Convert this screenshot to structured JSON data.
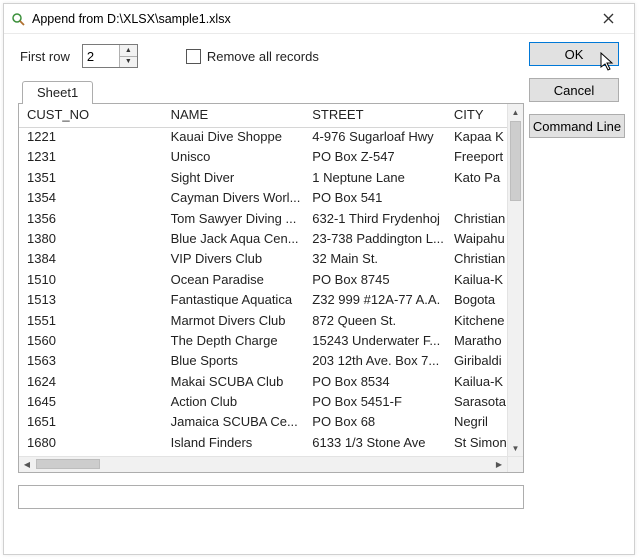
{
  "title": "Append from D:\\XLSX\\sample1.xlsx",
  "label_first_row": "First row",
  "first_row_value": "2",
  "checkbox_remove_label": "Remove all records",
  "buttons": {
    "ok": "OK",
    "cancel": "Cancel",
    "cmdline": "Command Line"
  },
  "sheet_tab": "Sheet1",
  "columns": [
    "CUST_NO",
    "NAME",
    "STREET",
    "CITY"
  ],
  "rows": [
    {
      "c0": "1221",
      "c1": "Kauai Dive Shoppe",
      "c2": "4-976 Sugarloaf Hwy",
      "c3": "Kapaa K"
    },
    {
      "c0": "1231",
      "c1": "Unisco",
      "c2": "PO Box Z-547",
      "c3": "Freeport"
    },
    {
      "c0": "1351",
      "c1": "Sight Diver",
      "c2": "1 Neptune Lane",
      "c3": "Kato Pa"
    },
    {
      "c0": "1354",
      "c1": "Cayman Divers Worl...",
      "c2": "PO Box 541",
      "c3": ""
    },
    {
      "c0": "1356",
      "c1": "Tom Sawyer Diving ...",
      "c2": "632-1 Third Frydenhoj",
      "c3": "Christian"
    },
    {
      "c0": "1380",
      "c1": "Blue Jack Aqua Cen...",
      "c2": "23-738 Paddington L...",
      "c3": "Waipahu"
    },
    {
      "c0": "1384",
      "c1": "VIP Divers Club",
      "c2": "32 Main St.",
      "c3": "Christian"
    },
    {
      "c0": "1510",
      "c1": "Ocean Paradise",
      "c2": "PO Box 8745",
      "c3": "Kailua-K"
    },
    {
      "c0": "1513",
      "c1": "Fantastique Aquatica",
      "c2": "Z32 999 #12A-77 A.A.",
      "c3": "Bogota"
    },
    {
      "c0": "1551",
      "c1": "Marmot Divers Club",
      "c2": "872 Queen St.",
      "c3": "Kitchene"
    },
    {
      "c0": "1560",
      "c1": "The Depth Charge",
      "c2": "15243 Underwater F...",
      "c3": "Maratho"
    },
    {
      "c0": "1563",
      "c1": "Blue Sports",
      "c2": "203 12th Ave. Box 7...",
      "c3": "Giribaldi"
    },
    {
      "c0": "1624",
      "c1": "Makai SCUBA Club",
      "c2": "PO Box 8534",
      "c3": "Kailua-K"
    },
    {
      "c0": "1645",
      "c1": "Action Club",
      "c2": "PO Box 5451-F",
      "c3": "Sarasota"
    },
    {
      "c0": "1651",
      "c1": "Jamaica SCUBA Ce...",
      "c2": "PO Box 68",
      "c3": "Negril"
    },
    {
      "c0": "1680",
      "c1": "Island Finders",
      "c2": "6133 1/3 Stone Ave",
      "c3": "St Simon"
    }
  ]
}
